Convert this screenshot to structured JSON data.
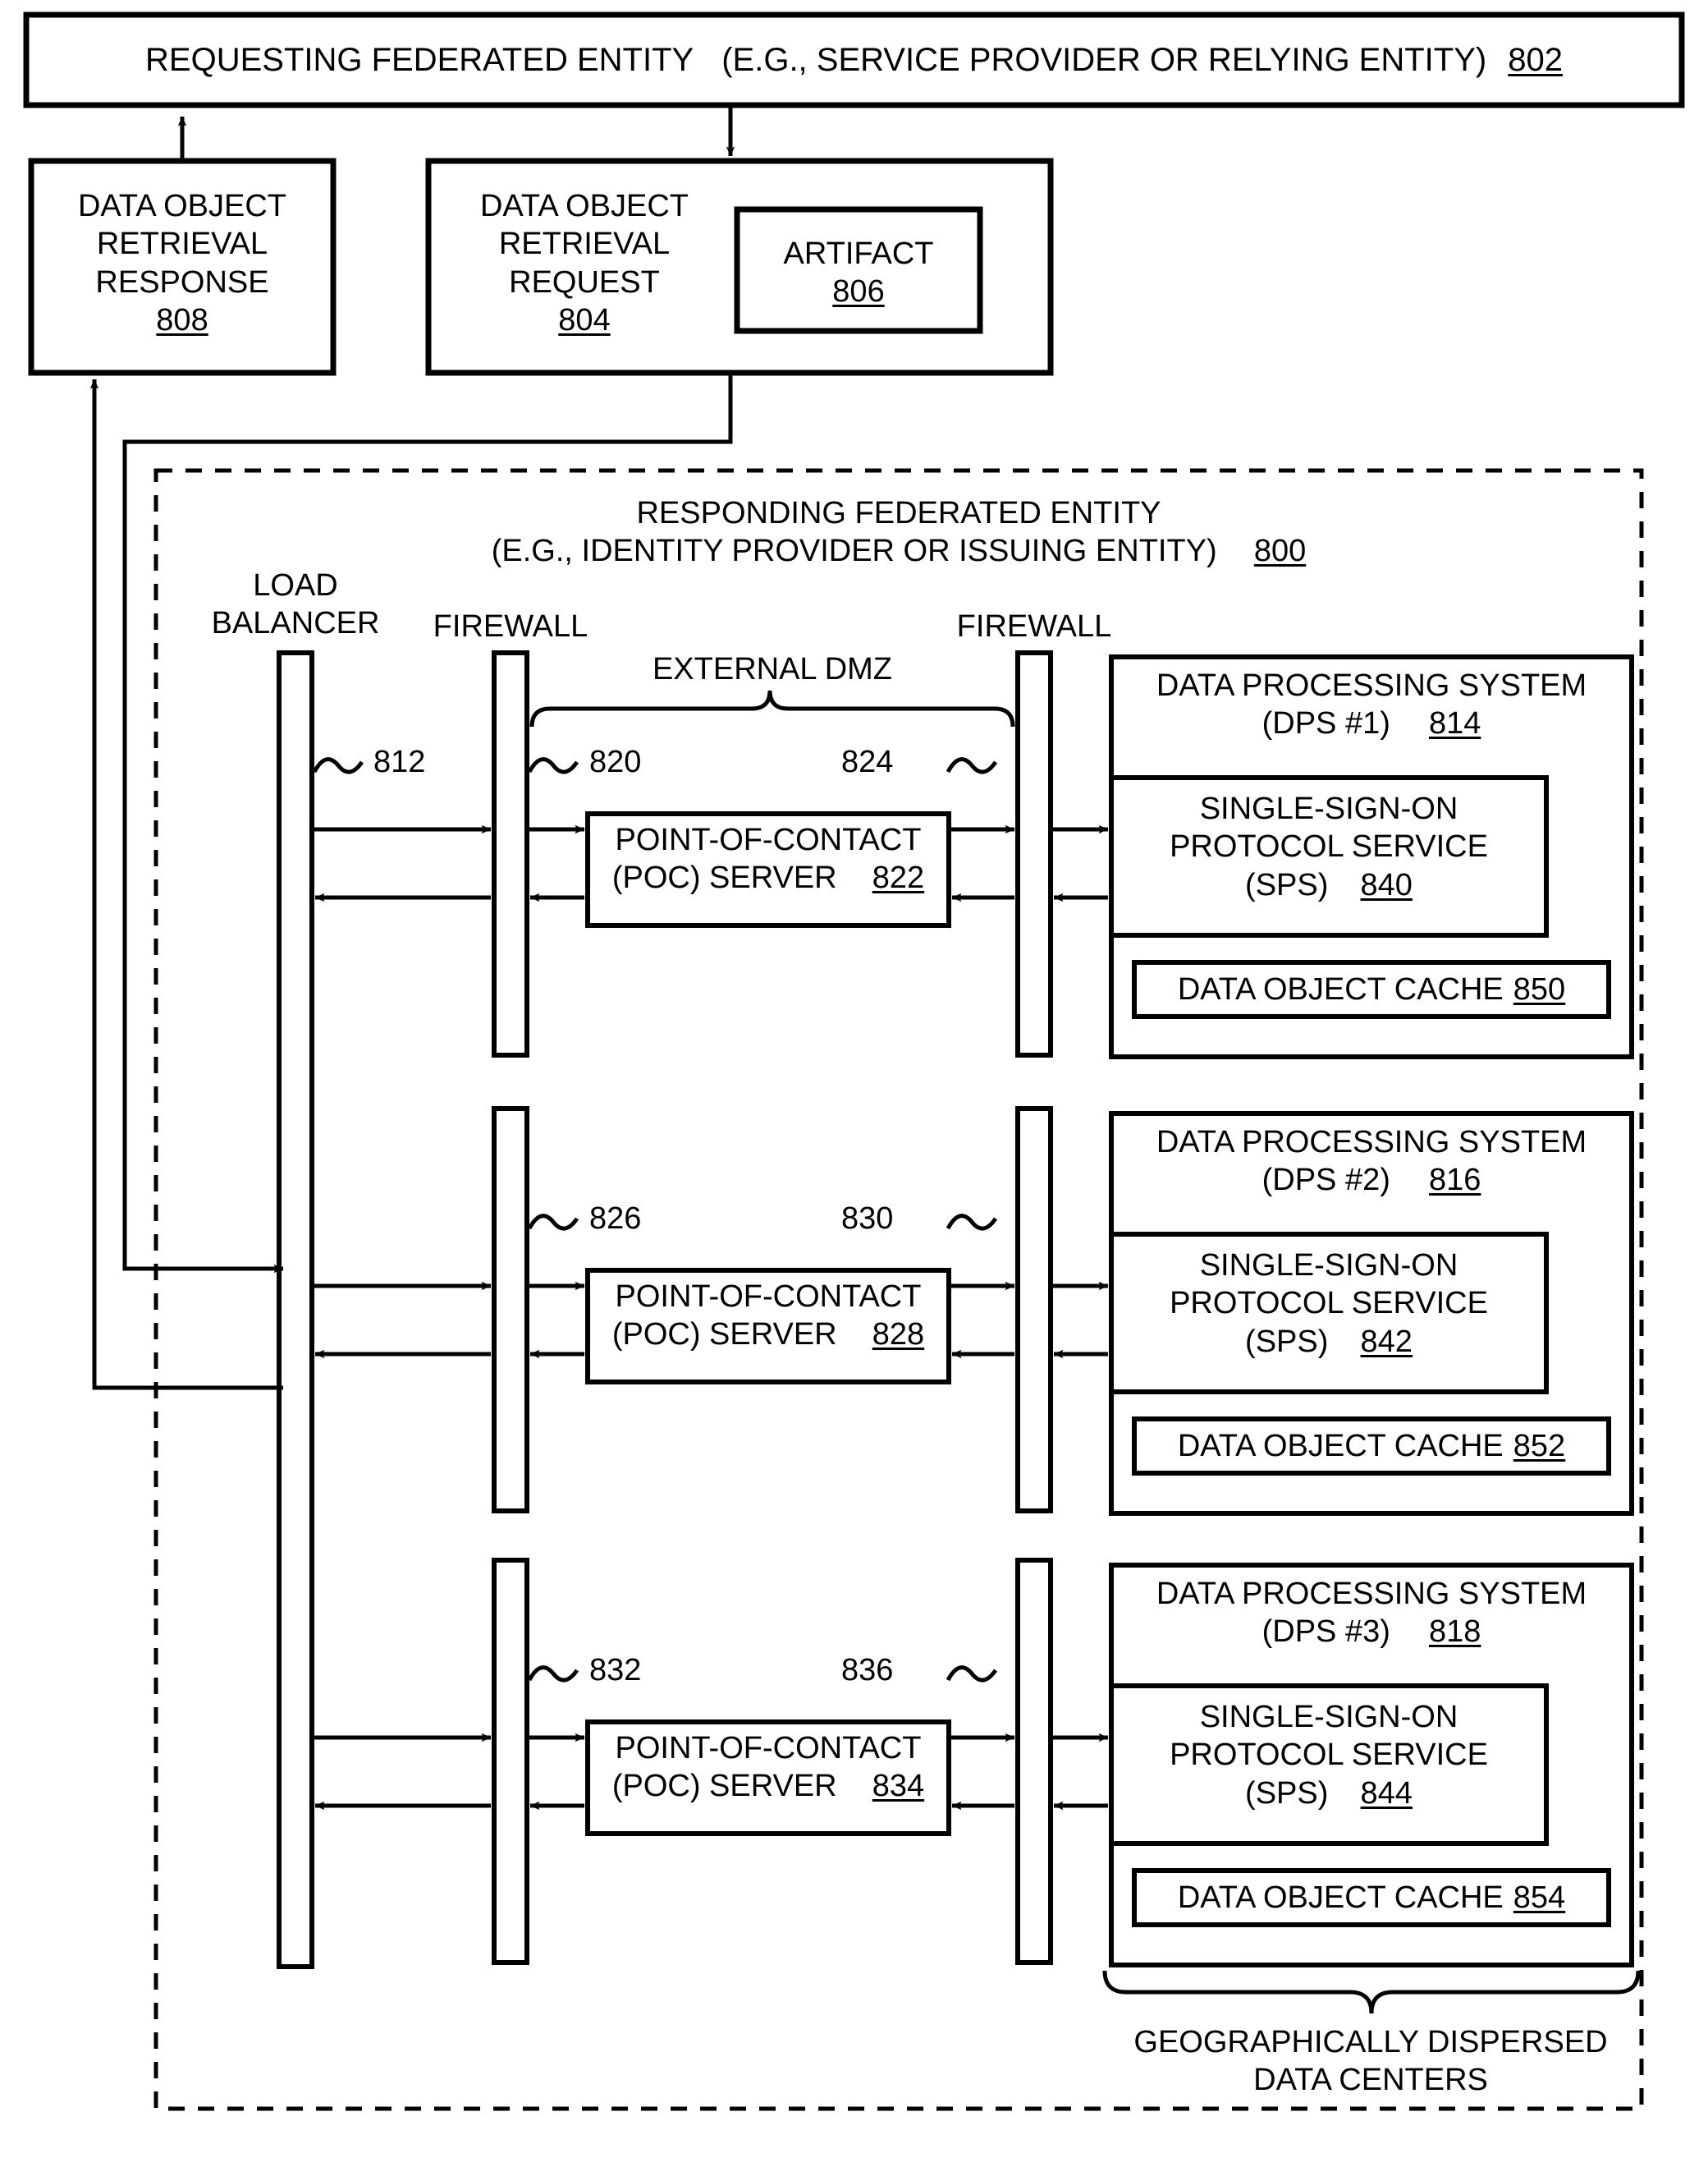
{
  "diagram": {
    "figure_kind": "patent-block-diagram",
    "requesting_entity": {
      "title": "REQUESTING FEDERATED ENTITY",
      "subtitle": "(E.G., SERVICE PROVIDER OR RELYING ENTITY)",
      "ref": "802"
    },
    "response_box": {
      "line1": "DATA OBJECT",
      "line2": "RETRIEVAL",
      "line3": "RESPONSE",
      "ref": "808"
    },
    "request_box": {
      "line1": "DATA OBJECT",
      "line2": "RETRIEVAL",
      "line3": "REQUEST",
      "ref": "804"
    },
    "artifact_box": {
      "label": "ARTIFACT",
      "ref": "806"
    },
    "responding_entity": {
      "title": "RESPONDING FEDERATED ENTITY",
      "subtitle": "(E.G., IDENTITY PROVIDER OR ISSUING ENTITY)",
      "ref": "800"
    },
    "load_balancer": {
      "line1": "LOAD",
      "line2": "BALANCER"
    },
    "firewall_left_label": "FIREWALL",
    "firewall_right_label": "FIREWALL",
    "dmz_label": "EXTERNAL DMZ",
    "datacenters_label": {
      "line1": "GEOGRAPHICALLY DISPERSED",
      "line2": "DATA CENTERS"
    },
    "rows": [
      {
        "lb_link_ref": "812",
        "fw_left_ref": "820",
        "fw_right_ref": "824",
        "poc": {
          "line1": "POINT-OF-CONTACT",
          "line2": "(POC) SERVER",
          "ref": "822"
        },
        "dps": {
          "line1": "DATA PROCESSING SYSTEM",
          "line2": "(DPS #1)",
          "ref": "814"
        },
        "sps": {
          "line1": "SINGLE-SIGN-ON",
          "line2": "PROTOCOL SERVICE",
          "line3": "(SPS)",
          "ref": "840"
        },
        "cache": {
          "label": "DATA OBJECT CACHE",
          "ref": "850"
        }
      },
      {
        "lb_link_ref": "",
        "fw_left_ref": "826",
        "fw_right_ref": "830",
        "poc": {
          "line1": "POINT-OF-CONTACT",
          "line2": "(POC) SERVER",
          "ref": "828"
        },
        "dps": {
          "line1": "DATA PROCESSING SYSTEM",
          "line2": "(DPS #2)",
          "ref": "816"
        },
        "sps": {
          "line1": "SINGLE-SIGN-ON",
          "line2": "PROTOCOL SERVICE",
          "line3": "(SPS)",
          "ref": "842"
        },
        "cache": {
          "label": "DATA OBJECT CACHE",
          "ref": "852"
        }
      },
      {
        "lb_link_ref": "",
        "fw_left_ref": "832",
        "fw_right_ref": "836",
        "poc": {
          "line1": "POINT-OF-CONTACT",
          "line2": "(POC) SERVER",
          "ref": "834"
        },
        "dps": {
          "line1": "DATA PROCESSING SYSTEM",
          "line2": "(DPS #3)",
          "ref": "818"
        },
        "sps": {
          "line1": "SINGLE-SIGN-ON",
          "line2": "PROTOCOL SERVICE",
          "line3": "(SPS)",
          "ref": "844"
        },
        "cache": {
          "label": "DATA OBJECT CACHE",
          "ref": "854"
        }
      }
    ],
    "colors": {
      "ink": "#000000",
      "paper": "#ffffff"
    }
  }
}
